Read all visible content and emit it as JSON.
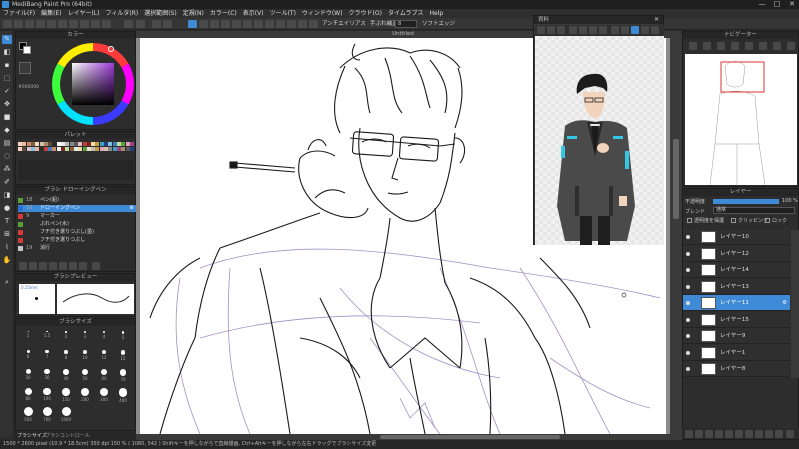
{
  "window": {
    "title": "MediBang Paint Pro (64bit)",
    "controls": [
      "—",
      "□",
      "✕"
    ]
  },
  "menu": [
    "ファイル(F)",
    "編集(E)",
    "レイヤー(L)",
    "フィルタ(R)",
    "選択範囲(S)",
    "定規(N)",
    "カラー(C)",
    "表示(V)",
    "ツール(T)",
    "ウィンドウ(W)",
    "クラウド(O)",
    "タイムラプス",
    "Help"
  ],
  "toolbar": {
    "antialias_label": "アンチエイリアス",
    "stabilizer_label": "手ぶれ補正",
    "stabilizer_value": "8",
    "softedge_label": "ソフトエッジ"
  },
  "panels": {
    "color_title": "カラー",
    "palette_title": "パレット",
    "brush_title": "ブラシ ドローイングペン",
    "brush_preview_title": "ブラシプレビュー",
    "brush_preview_size": "0.25mm",
    "brush_size_title": "ブラシサイズ",
    "hex_value": "#000000",
    "navigator_title": "ナビゲーター",
    "reference_title": "資料",
    "layer_title": "レイヤー",
    "opacity_label": "不透明度",
    "opacity_value": "100 %",
    "blend_label": "ブレンド",
    "blend_value": "通常",
    "protect_alpha_label": "透明度を保護",
    "clipping_label": "クリッピング",
    "lock_label": "ロック",
    "bottom_tab_brush_size": "ブラシサイズ",
    "bottom_tab_brush_control": "ブラシコントロール"
  },
  "canvas": {
    "tab_title": "Untitled"
  },
  "brushes": [
    {
      "num": "18",
      "name": "ペン(鉛)",
      "color": "#5a9e3a",
      "selected": false
    },
    {
      "num": "10",
      "name": "ドローイングペン",
      "color": "#2a6fd4",
      "selected": true
    },
    {
      "num": "9",
      "name": "マーカー",
      "color": "#d43a3a",
      "selected": false
    },
    {
      "num": "",
      "name": "ぶれペン(水)",
      "color": "#5a9e3a",
      "selected": false
    },
    {
      "num": "",
      "name": "フチ付き選りつぶし(墨)",
      "color": "#d43a3a",
      "selected": false
    },
    {
      "num": "",
      "name": "フチ付き選りつぶし",
      "color": "#d43a3a",
      "selected": false
    },
    {
      "num": "19",
      "name": "消行",
      "color": "#c8c8c8",
      "selected": false
    }
  ],
  "brush_sizes": [
    "1",
    "1.5",
    "2",
    "3",
    "4",
    "5",
    "6",
    "7",
    "8",
    "10",
    "12",
    "15",
    "20",
    "30",
    "40",
    "50",
    "60",
    "70",
    "80",
    "100",
    "150",
    "200",
    "300",
    "400",
    "500",
    "700",
    "1000"
  ],
  "layers": [
    {
      "name": "レイヤー10",
      "selected": false
    },
    {
      "name": "レイヤー12",
      "selected": false
    },
    {
      "name": "レイヤー14",
      "selected": false
    },
    {
      "name": "レイヤー13",
      "selected": false
    },
    {
      "name": "レイヤー11",
      "selected": true
    },
    {
      "name": "レイヤー15",
      "selected": false
    },
    {
      "name": "レイヤー9",
      "selected": false
    },
    {
      "name": "レイヤー1",
      "selected": false
    },
    {
      "name": "レイヤー8",
      "selected": false
    }
  ],
  "status": {
    "text": "1500 * 2600 pixel  (10.9 * 18.5cm)  350 dpi  150 %  ( 1080, 542 )  Shiftキーを押しながらで直線描画, Ctrl+Altキーを押しながら左右ドラッグでブラシサイズ変更"
  },
  "colors": {
    "accent": "#3e8ad6",
    "panel_bg": "#2d2d2d",
    "sketch_line": "#a58fc4"
  }
}
